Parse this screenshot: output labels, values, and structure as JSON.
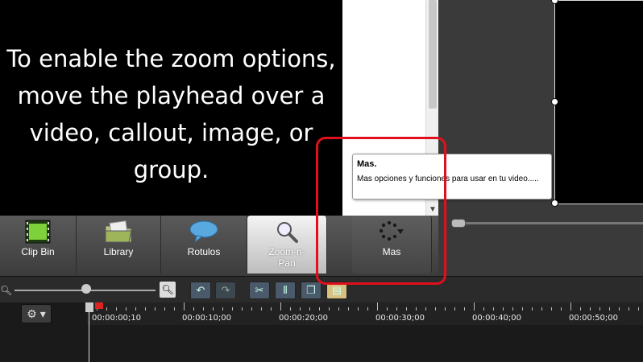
{
  "zoom_panel": {
    "message": "To enable the zoom options,\nmove the playhead over a\nvideo, callout, image, or\ngroup."
  },
  "tooltip": {
    "title": "Mas.",
    "body": "Mas opciones y funciones para usar en tu video....."
  },
  "tabs": [
    {
      "label": "Clip Bin",
      "icon": "film-icon"
    },
    {
      "label": "Library",
      "icon": "folder-icon"
    },
    {
      "label": "Rotulos",
      "icon": "callout-bubble-icon"
    },
    {
      "label": "Zoom-n-\nPan",
      "icon": "magnifier-icon"
    },
    {
      "label": "Mas",
      "icon": "more-spinner-icon"
    }
  ],
  "timeline": {
    "tick_labels": [
      "00:00:00;10",
      "00:00:10;00",
      "00:00:20;00",
      "00:00:30;00",
      "00:00:40;00",
      "00:00:50;00"
    ]
  },
  "colors": {
    "annotation": "#e0101c",
    "panel_bg": "#000000"
  }
}
